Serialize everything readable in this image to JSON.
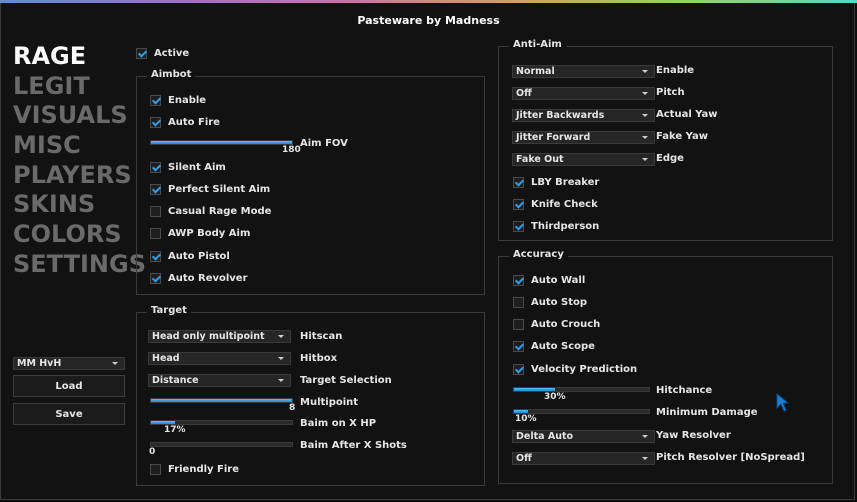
{
  "title": "Pasteware by Madness",
  "nav": [
    "RAGE",
    "LEGIT",
    "VISUALS",
    "MISC",
    "PLAYERS",
    "SKINS",
    "COLORS",
    "SETTINGS"
  ],
  "config": {
    "selected": "MM HvH",
    "load": "Load",
    "save": "Save"
  },
  "active": {
    "label": "Active",
    "checked": true
  },
  "aimbot": {
    "title": "Aimbot",
    "enable": "Enable",
    "auto_fire": "Auto Fire",
    "aim_fov": {
      "label": "Aim FOV",
      "value": "180",
      "fraction": 1.0
    },
    "silent_aim": "Silent Aim",
    "perfect_silent_aim": "Perfect Silent Aim",
    "casual_rage_mode": "Casual Rage Mode",
    "awp_body_aim": "AWP Body Aim",
    "auto_pistol": "Auto Pistol",
    "auto_revolver": "Auto Revolver"
  },
  "target": {
    "title": "Target",
    "hitscan": {
      "value": "Head only multipoint",
      "label": "Hitscan"
    },
    "hitbox": {
      "value": "Head",
      "label": "Hitbox"
    },
    "target_selection": {
      "value": "Distance",
      "label": "Target Selection"
    },
    "multipoint": {
      "label": "Multipoint",
      "value": "8",
      "fraction": 1.0
    },
    "baim_hp": {
      "label": "Baim on X HP",
      "value": "17%",
      "fraction": 0.17
    },
    "baim_shots": {
      "label": "Baim After X Shots",
      "value": "0",
      "fraction": 0.0
    },
    "friendly_fire": "Friendly Fire"
  },
  "antiaim": {
    "title": "Anti-Aim",
    "enable": {
      "value": "Normal",
      "label": "Enable"
    },
    "pitch": {
      "value": "Off",
      "label": "Pitch"
    },
    "actual_yaw": {
      "value": "Jitter Backwards",
      "label": "Actual Yaw"
    },
    "fake_yaw": {
      "value": "Jitter Forward",
      "label": "Fake Yaw"
    },
    "edge": {
      "value": "Fake Out",
      "label": "Edge"
    },
    "lby_breaker": "LBY Breaker",
    "knife_check": "Knife Check",
    "thirdperson": "Thirdperson"
  },
  "accuracy": {
    "title": "Accuracy",
    "auto_wall": "Auto Wall",
    "auto_stop": "Auto Stop",
    "auto_crouch": "Auto Crouch",
    "auto_scope": "Auto Scope",
    "velocity_prediction": "Velocity Prediction",
    "hitchance": {
      "label": "Hitchance",
      "value": "30%",
      "fraction": 0.3
    },
    "min_damage": {
      "label": "Minimum Damage",
      "value": "10%",
      "fraction": 0.1
    },
    "yaw_resolver": {
      "value": "Delta Auto",
      "label": "Yaw Resolver"
    },
    "pitch_resolver": {
      "value": "Off",
      "label": "Pitch Resolver [NoSpread]"
    }
  },
  "colors": {
    "accent": "#2f9ce6",
    "active_nav": "#ffffff",
    "inactive_nav": "#6a6a6a"
  }
}
